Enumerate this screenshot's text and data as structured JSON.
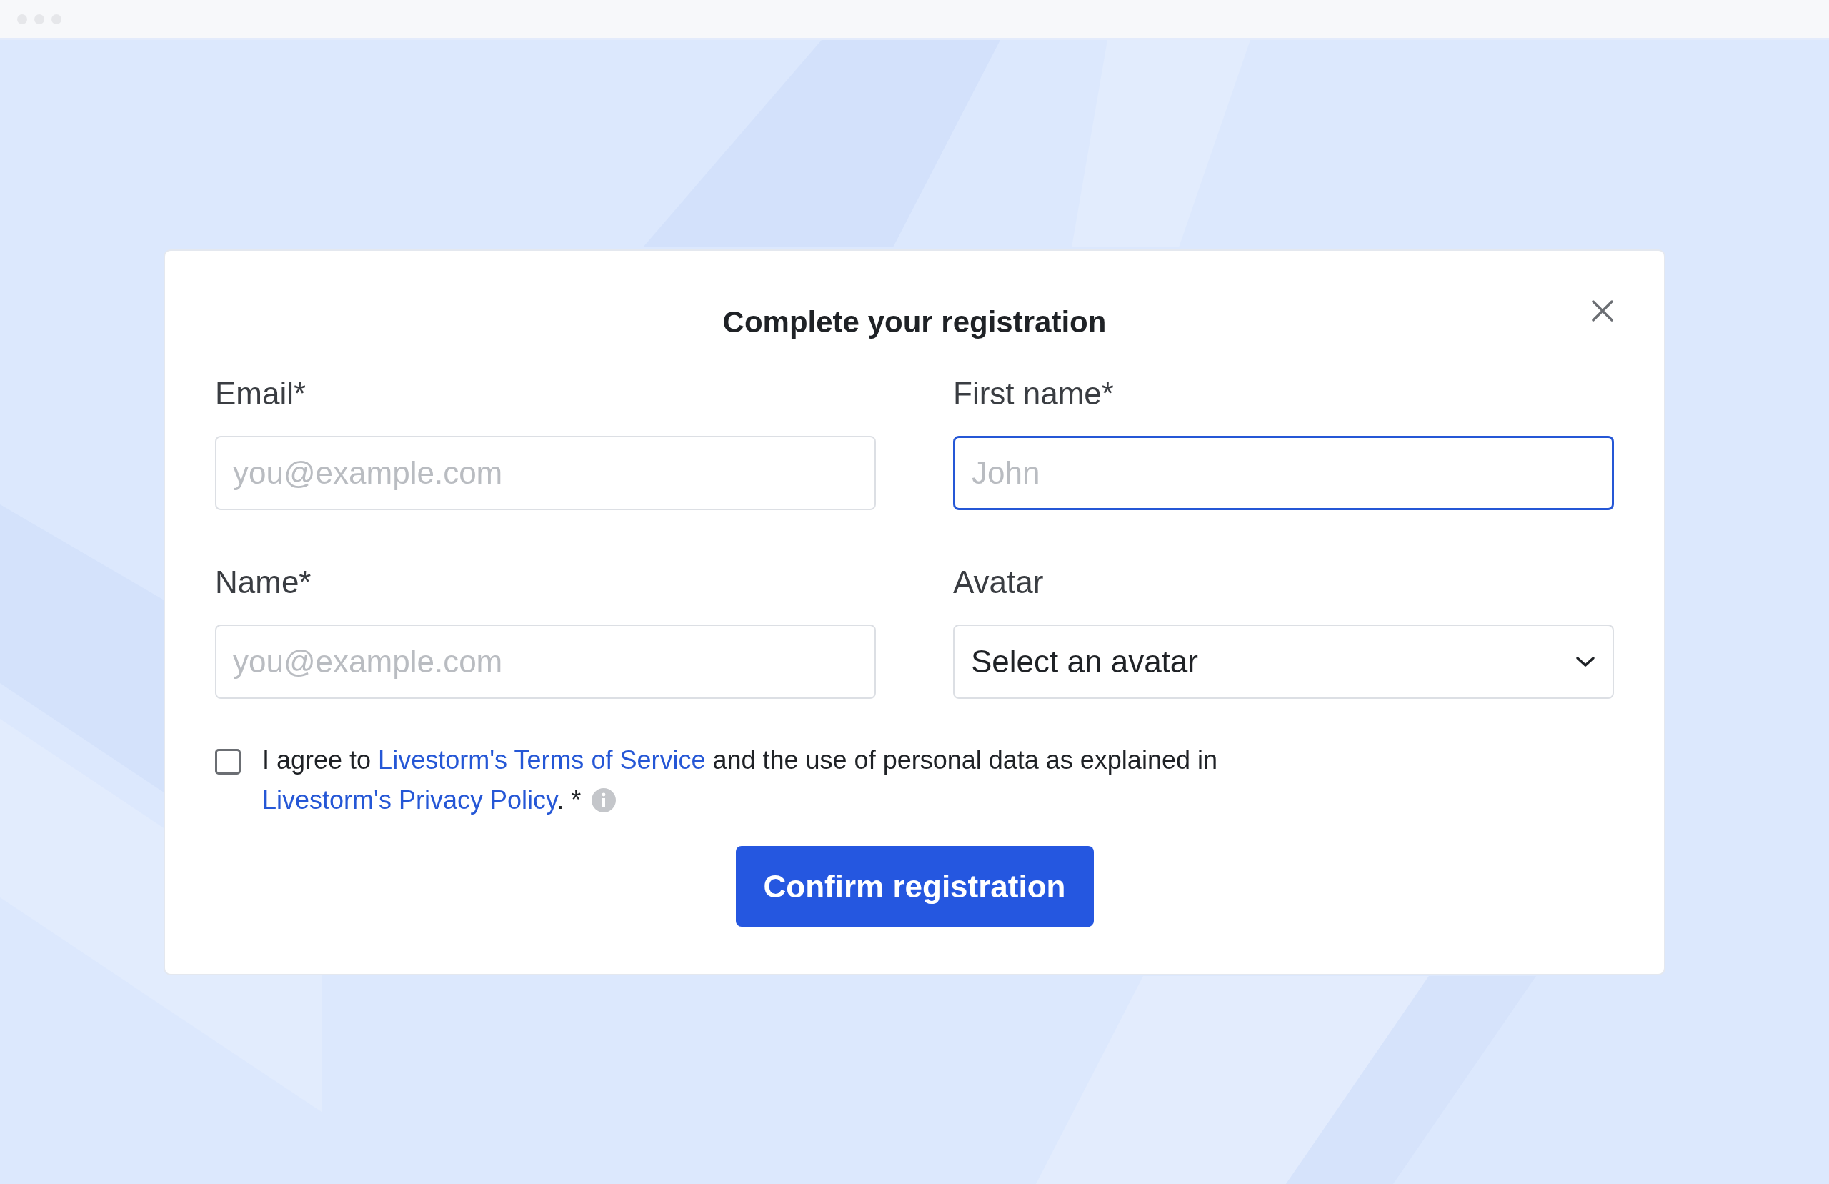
{
  "dialog": {
    "title": "Complete your registration",
    "fields": [
      {
        "kind": "text",
        "label": "Email*",
        "placeholder": "you@example.com",
        "focused": false
      },
      {
        "kind": "text",
        "label": "First name*",
        "placeholder": "John",
        "focused": true
      },
      {
        "kind": "text",
        "label": "Name*",
        "placeholder": "you@example.com",
        "focused": false
      },
      {
        "kind": "select",
        "label": "Avatar",
        "value": "Select an avatar",
        "focused": false
      }
    ],
    "consent": {
      "checked": false,
      "parts": [
        {
          "kind": "text",
          "text": "I agree to "
        },
        {
          "kind": "link",
          "text": "Livestorm's Terms of Service"
        },
        {
          "kind": "text",
          "text": " and the use of personal data as explained in "
        },
        {
          "kind": "link",
          "text": "Livestorm's Privacy Policy"
        },
        {
          "kind": "text",
          "text": ". *"
        }
      ]
    },
    "submit": "Confirm registration"
  }
}
